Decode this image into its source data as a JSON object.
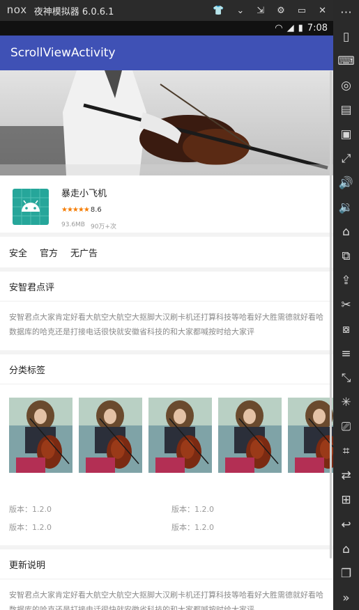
{
  "emulator": {
    "logo": "nox",
    "title": "夜神模拟器 6.0.6.1"
  },
  "status_bar": {
    "time": "7:08"
  },
  "action_bar": {
    "title": "ScrollViewActivity"
  },
  "app": {
    "name": "暴走小飞机",
    "stars": "★★★★★",
    "rating": "8.6",
    "size": "93.6MB",
    "downloads": "90万+次"
  },
  "tags": [
    "安全",
    "官方",
    "无广告"
  ],
  "review": {
    "title": "安智君点评",
    "text": "安智君点大家肯定好看大航空大航空大抠脚大汉刷卡机还打算科技等哈看好大胜需德就好看哈数据库的哈克还是打接电话很快就安徽省科技的和大家都喊按时给大家评"
  },
  "category": {
    "title": "分类标签",
    "images": [
      "cellist",
      "cellist",
      "cellist",
      "cellist",
      "cellist"
    ],
    "versions": [
      "版本：1.2.0",
      "版本：1.2.0",
      "版本：1.2.0",
      "版本：1.2.0"
    ]
  },
  "update": {
    "title": "更新说明",
    "text": "安智君点大家肯定好看大航空大航空大抠脚大汉刷卡机还打算科技等哈看好大胜需德就好看哈数据库的哈克还是打接电话很快就安徽省科技的和大家都喊按时给大家评"
  },
  "colors": {
    "action_bar": "#3f51b5",
    "app_icon": "#26a69a",
    "stars": "#f57c00"
  }
}
